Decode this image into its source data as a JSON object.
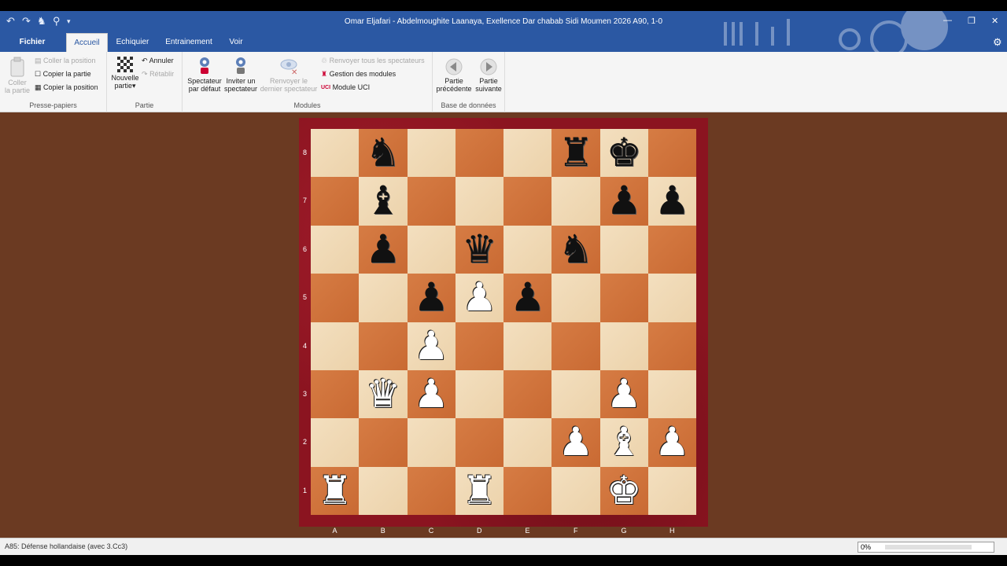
{
  "window": {
    "title": "Omar Eljafari - Abdelmoughite Laanaya, Exellence Dar chabab Sidi Moumen 2026  A90, 1-0"
  },
  "quick_access": [
    "undo-icon",
    "redo-icon",
    "knight-icon",
    "pin-icon",
    "more-icon"
  ],
  "window_controls": [
    "minimize-icon",
    "restore-icon",
    "close-icon"
  ],
  "tabs": {
    "file": "Fichier",
    "items": [
      "Accueil",
      "Echiquier",
      "Entrainement",
      "Voir"
    ],
    "active": "Accueil"
  },
  "ribbon": {
    "clipboard": {
      "label": "Presse-papiers",
      "paste": "Coller\nla partie",
      "paste_position": "Coller la position",
      "copy_game": "Copier la partie",
      "copy_position": "Copier la position"
    },
    "game": {
      "label": "Partie",
      "new_game": "Nouvelle",
      "new_game_2": "partie",
      "undo": "Annuler",
      "redo": "Rétablir"
    },
    "engines": {
      "label": "Modules",
      "spectator": "Spectateur",
      "spectator_2": "par défaut",
      "invite": "Inviter un",
      "invite_2": "spectateur",
      "send_last": "Renvoyer le",
      "send_last_2": "dernier spectateur",
      "send_all": "Renvoyer tous les spectateurs",
      "manage": "Gestion des modules",
      "uci": "Module UCI"
    },
    "database": {
      "label": "Base de données",
      "prev": "Partie",
      "prev_2": "précédente",
      "next": "Partie",
      "next_2": "suivante"
    }
  },
  "board": {
    "files": [
      "A",
      "B",
      "C",
      "D",
      "E",
      "F",
      "G",
      "H"
    ],
    "ranks": [
      "8",
      "7",
      "6",
      "5",
      "4",
      "3",
      "2",
      "1"
    ],
    "pieces": [
      {
        "sq": "b8",
        "glyph": "♞",
        "color": "b"
      },
      {
        "sq": "f8",
        "glyph": "♜",
        "color": "b"
      },
      {
        "sq": "g8",
        "glyph": "♚",
        "color": "b"
      },
      {
        "sq": "b7",
        "glyph": "♝",
        "color": "b"
      },
      {
        "sq": "g7",
        "glyph": "♟",
        "color": "b"
      },
      {
        "sq": "h7",
        "glyph": "♟",
        "color": "b"
      },
      {
        "sq": "b6",
        "glyph": "♟",
        "color": "b"
      },
      {
        "sq": "d6",
        "glyph": "♛",
        "color": "b"
      },
      {
        "sq": "f6",
        "glyph": "♞",
        "color": "b"
      },
      {
        "sq": "c5",
        "glyph": "♟",
        "color": "b"
      },
      {
        "sq": "d5",
        "glyph": "♟",
        "color": "w"
      },
      {
        "sq": "e5",
        "glyph": "♟",
        "color": "b"
      },
      {
        "sq": "c4",
        "glyph": "♟",
        "color": "w"
      },
      {
        "sq": "b3",
        "glyph": "♛",
        "color": "w"
      },
      {
        "sq": "c3",
        "glyph": "♟",
        "color": "w"
      },
      {
        "sq": "g3",
        "glyph": "♟",
        "color": "w"
      },
      {
        "sq": "f2",
        "glyph": "♟",
        "color": "w"
      },
      {
        "sq": "g2",
        "glyph": "♝",
        "color": "w"
      },
      {
        "sq": "h2",
        "glyph": "♟",
        "color": "w"
      },
      {
        "sq": "a1",
        "glyph": "♜",
        "color": "w"
      },
      {
        "sq": "d1",
        "glyph": "♜",
        "color": "w"
      },
      {
        "sq": "g1",
        "glyph": "♚",
        "color": "w"
      }
    ]
  },
  "status": {
    "opening": "A85: Défense hollandaise (avec 3.Cc3)",
    "progress_text": "0%",
    "progress_value": 0
  },
  "colors": {
    "titlebar": "#2b58a3",
    "light_square": "#f1d9b5",
    "dark_square": "#d2763f",
    "frame": "#8b1420"
  }
}
